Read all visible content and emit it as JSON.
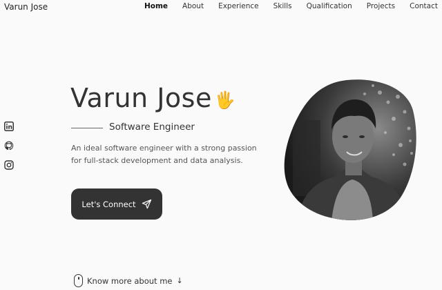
{
  "nav": {
    "brand": "Varun Jose",
    "items": [
      {
        "label": "Home"
      },
      {
        "label": "About"
      },
      {
        "label": "Experience"
      },
      {
        "label": "Skills"
      },
      {
        "label": "Qualification"
      },
      {
        "label": "Projects"
      },
      {
        "label": "Contact"
      }
    ],
    "active": "Home"
  },
  "social": {
    "icons": [
      "linkedin-icon",
      "github-icon",
      "instagram-icon"
    ]
  },
  "hero": {
    "name": "Varun Jose",
    "wave": "🖐",
    "role": "Software Engineer",
    "description": "An ideal software engineer with a strong passion for full-stack development and data analysis.",
    "cta_label": "Let's Connect",
    "cta_icon": "send-icon"
  },
  "scroll": {
    "label": "Know more about me",
    "arrow": "↓",
    "icon": "mouse-icon"
  },
  "colors": {
    "background": "#fafafa",
    "text": "#2d2d2d",
    "button": "#333333"
  }
}
